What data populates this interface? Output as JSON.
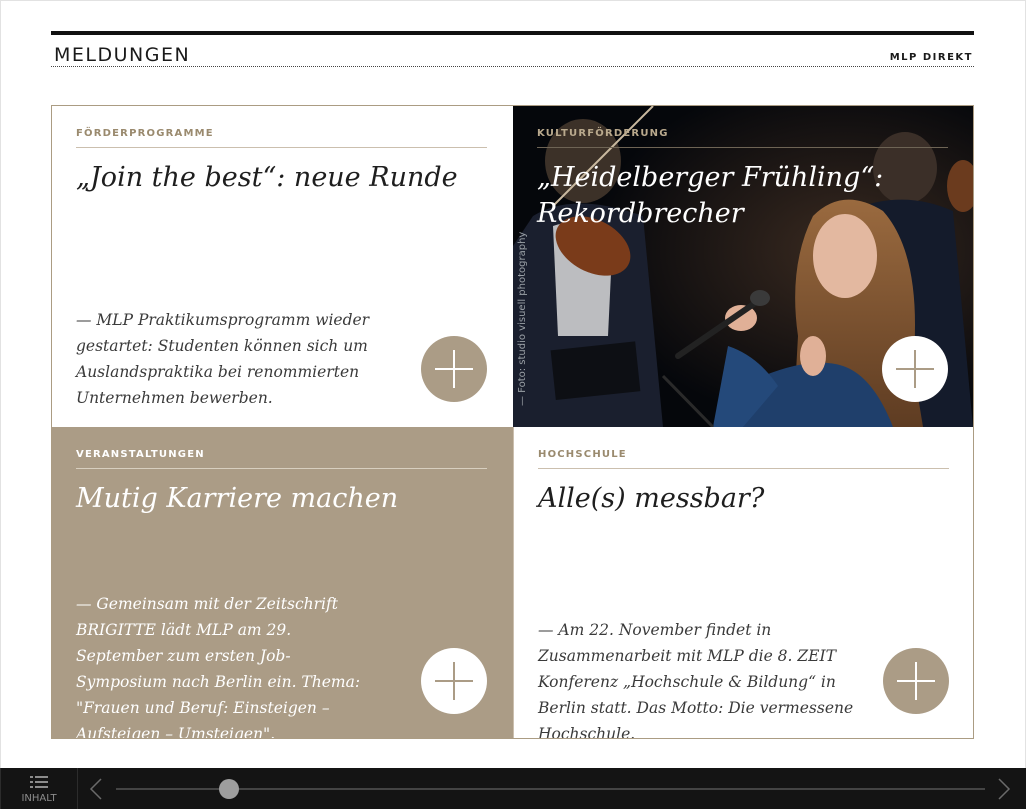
{
  "header": {
    "title": "MELDUNGEN",
    "link": "MLP DIREKT"
  },
  "tiles": [
    {
      "category": "FÖRDERPROGRAMME",
      "title": "„Join the best“: neue Runde",
      "teaser": "— MLP Praktikumsprogramm wieder gestartet: Studenten können sich um Auslandspraktika bei renommierten Unternehmen bewerben."
    },
    {
      "category": "KULTURFÖRDERUNG",
      "title": "„Heidelberger Frühling“: Rekordbrecher",
      "photo_credit": "— Foto: studio visuell photography"
    },
    {
      "category": "VERANSTALTUNGEN",
      "title": "Mutig Karriere machen",
      "teaser": "— Gemeinsam mit der Zeitschrift BRIGITTE lädt MLP am 29. September zum ersten Job-Symposium nach Berlin ein. Thema: \"Frauen und Beruf: Einsteigen – Aufsteigen – Umsteigen\"."
    },
    {
      "category": "HOCHSCHULE",
      "title": "Alle(s) messbar?",
      "teaser": "— Am 22. November findet in Zusammenarbeit mit MLP die 8. ZEIT Konferenz „Hochschule & Bildung“ in Berlin statt. Das Motto: Die vermessene Hochschule."
    }
  ],
  "footer": {
    "toc_label": "INHALT",
    "progress_fraction": 0.13
  },
  "colors": {
    "accent": "#ab9c86",
    "footer": "#141414",
    "text": "#2b2b2b"
  },
  "icons": [
    "plus-icon",
    "menu-list-icon",
    "chevron-left-icon",
    "chevron-right-icon"
  ]
}
